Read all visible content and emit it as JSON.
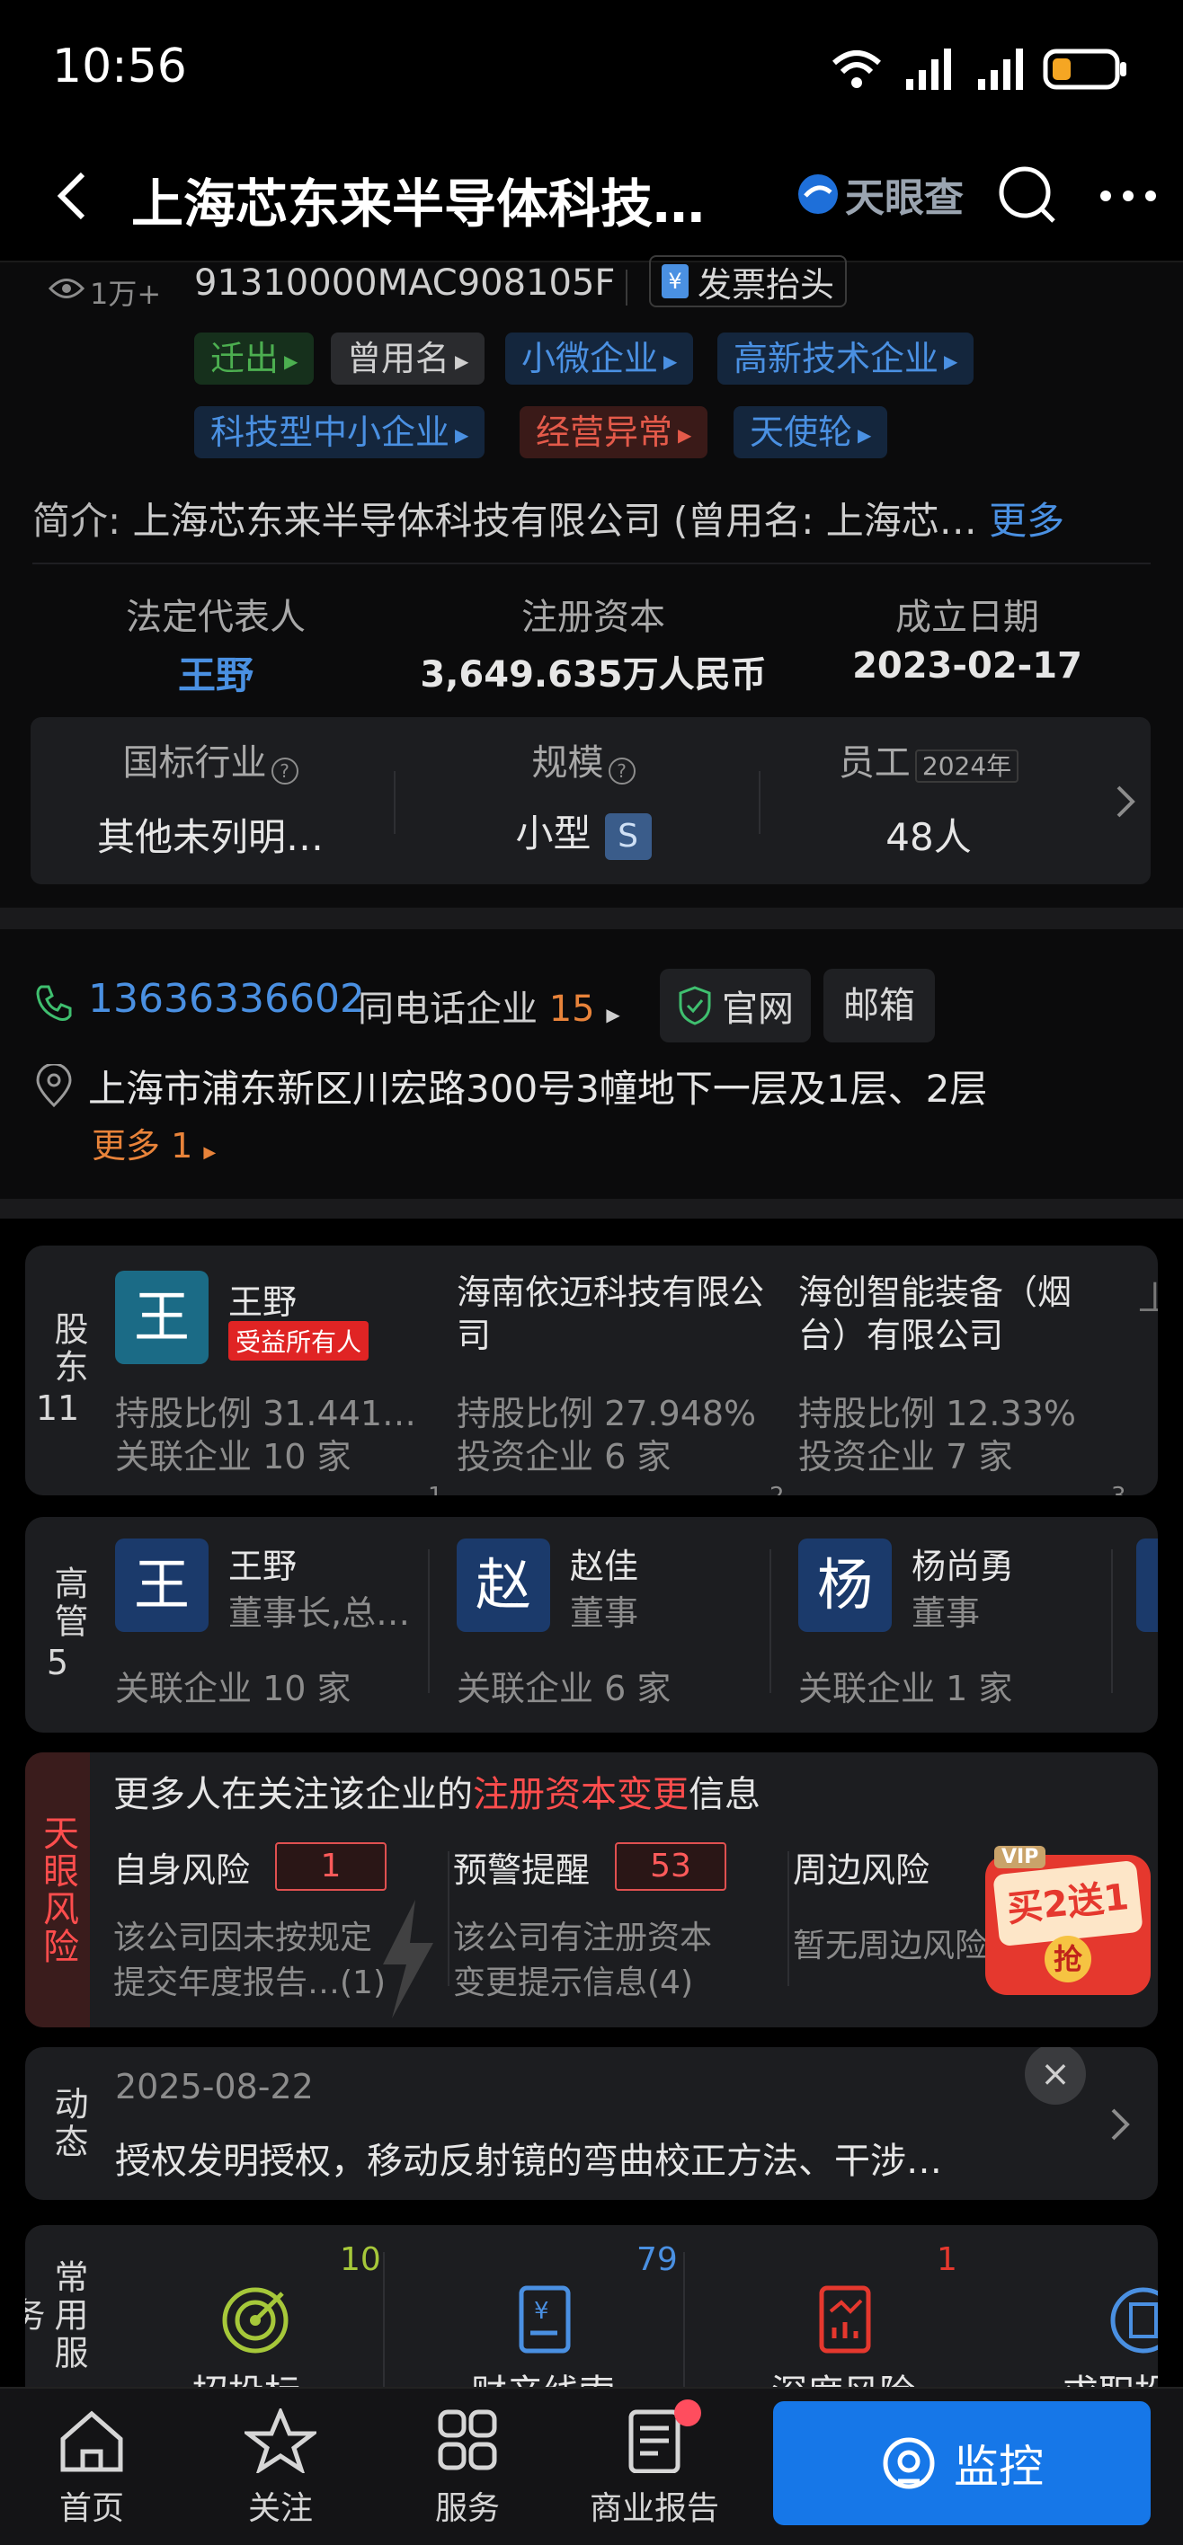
{
  "status_bar": {
    "time": "10:56",
    "battery_color": "#f5a623"
  },
  "header": {
    "back_icon": "chevron-left-icon",
    "title": "上海芯东来半导体科技…",
    "brand": "天眼查",
    "search_icon": "search-icon",
    "more_icon": "more-dots-icon"
  },
  "company": {
    "views": "1万+",
    "credit_code": "91310000MAC908105F",
    "invoice_label": "发票抬头",
    "tags_row1": [
      {
        "label": "迁出",
        "color": "#4caf50",
        "bg": "#16301c"
      },
      {
        "label": "曾用名",
        "color": "#cfcfcf",
        "bg": "#2a2b2e"
      },
      {
        "label": "小微企业",
        "color": "#4a90e2",
        "bg": "#14263d"
      },
      {
        "label": "高新技术企业",
        "color": "#4a90e2",
        "bg": "#14263d"
      }
    ],
    "tags_row2": [
      {
        "label": "科技型中小企业",
        "color": "#4a90e2",
        "bg": "#14263d"
      },
      {
        "label": "经营异常",
        "color": "#e45a4a",
        "bg": "#3a1a18"
      },
      {
        "label": "天使轮",
        "color": "#4a90e2",
        "bg": "#14263d"
      }
    ],
    "intro_label": "简介:",
    "intro_text": "上海芯东来半导体科技有限公司 (曾用名: 上海芯…",
    "intro_more": "更多"
  },
  "key_info": {
    "legal_rep_label": "法定代表人",
    "legal_rep": "王野",
    "capital_label": "注册资本",
    "capital": "3,649.635万人民币",
    "date_label": "成立日期",
    "date": "2023-02-17"
  },
  "industry_box": {
    "industry_label": "国标行业",
    "industry": "其他未列明…",
    "scale_label": "规模",
    "scale": "小型",
    "scale_badge": "S",
    "staff_label": "员工",
    "staff_year": "2024年",
    "staff": "48人"
  },
  "contact": {
    "phone": "13636336602",
    "same_phone_label": "同电话企业",
    "same_phone_count": "15",
    "website": "官网",
    "email": "邮箱",
    "address": "上海市浦东新区川宏路300号3幢地下一层及1层、2层",
    "more": "更多 1"
  },
  "shareholders": {
    "label": "股东",
    "count": "11",
    "items": [
      {
        "avatar": "王",
        "name": "王野",
        "badge": "受益所有人",
        "ratio": "持股比例 31.441…",
        "related": "关联企业 10 家",
        "index": "1"
      },
      {
        "name": "海南依迈科技有限公司",
        "ratio": "持股比例 27.948%",
        "related": "投资企业 6 家",
        "index": "2"
      },
      {
        "name": "海创智能装备（烟台）有限公司",
        "ratio": "持股比例 12.33%",
        "related": "投资企业 7 家",
        "index": "3"
      }
    ]
  },
  "executives": {
    "label": "高管",
    "count": "5",
    "items": [
      {
        "avatar": "王",
        "name": "王野",
        "role": "董事长,总…",
        "related": "关联企业 10 家"
      },
      {
        "avatar": "赵",
        "name": "赵佳",
        "role": "董事",
        "related": "关联企业 6 家"
      },
      {
        "avatar": "杨",
        "name": "杨尚勇",
        "role": "董事",
        "related": "关联企业 1 家"
      }
    ]
  },
  "risk": {
    "label": "天眼风险",
    "banner_prefix": "更多人在关注该企业的",
    "banner_highlight": "注册资本变更",
    "banner_suffix": "信息",
    "self_label": "自身风险",
    "self_count": "1",
    "self_desc1": "该公司因未按规定",
    "self_desc2": "提交年度报告…(1)",
    "warn_label": "预警提醒",
    "warn_count": "53",
    "warn_desc1": "该公司有注册资本",
    "warn_desc2": "变更提示信息(4)",
    "around_label": "周边风险",
    "around_desc": "暂无周边风险",
    "promo_vip": "VIP",
    "promo_text": "买2送1",
    "promo_btn": "抢"
  },
  "news": {
    "label": "动态",
    "date": "2025-08-22",
    "text": "授权发明授权，移动反射镜的弯曲校正方法、干涉…"
  },
  "services": {
    "label": "常用服务",
    "items": [
      {
        "count": "10",
        "label": "招投标",
        "icon": "target-icon"
      },
      {
        "count": "79",
        "label": "财产线索",
        "icon": "money-doc-icon"
      },
      {
        "count": "1",
        "label": "深度风险",
        "icon": "risk-chart-icon"
      },
      {
        "count": "",
        "label": "求职投",
        "icon": "building-icon"
      }
    ]
  },
  "bottom_nav": {
    "items": [
      {
        "label": "首页",
        "icon": "home-icon"
      },
      {
        "label": "关注",
        "icon": "star-icon"
      },
      {
        "label": "服务",
        "icon": "grid-icon"
      },
      {
        "label": "商业报告",
        "icon": "report-icon"
      }
    ],
    "monitor": "监控"
  }
}
